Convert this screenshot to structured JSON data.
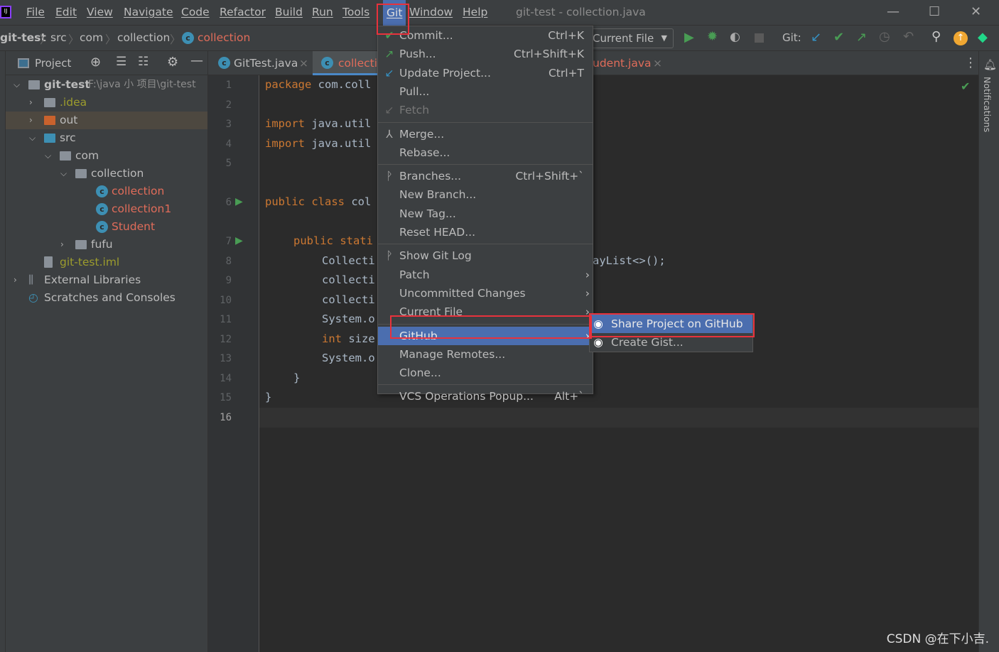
{
  "menubar": {
    "items": [
      "File",
      "Edit",
      "View",
      "Navigate",
      "Code",
      "Refactor",
      "Build",
      "Run",
      "Tools",
      "Git",
      "Window",
      "Help"
    ],
    "title": "git-test - collection.java"
  },
  "breadcrumb": [
    "git-test",
    "src",
    "com",
    "collection",
    "collection"
  ],
  "toolbar": {
    "run_config": "Current File",
    "git_label": "Git:"
  },
  "project": {
    "title": "Project",
    "tree": [
      {
        "label": "git-test",
        "extra": "F:\\java 小 项目\\git-test",
        "depth": 0,
        "open": true,
        "icon": "module-folder",
        "color": "#bbbbbb",
        "bold": true
      },
      {
        "label": ".idea",
        "depth": 1,
        "open": false,
        "icon": "folder",
        "color": "#9c9c2d"
      },
      {
        "label": "out",
        "depth": 1,
        "open": false,
        "icon": "excluded-folder",
        "color": "#bbbbbb",
        "highlight": true
      },
      {
        "label": "src",
        "depth": 1,
        "open": true,
        "icon": "source-folder",
        "color": "#bbbbbb"
      },
      {
        "label": "com",
        "depth": 2,
        "open": true,
        "icon": "package",
        "color": "#bbbbbb"
      },
      {
        "label": "collection",
        "depth": 3,
        "open": true,
        "icon": "package",
        "color": "#bbbbbb"
      },
      {
        "label": "collection",
        "depth": 4,
        "icon": "class-runnable",
        "color": "#e06c5a"
      },
      {
        "label": "collection1",
        "depth": 4,
        "icon": "class-runnable",
        "color": "#e06c5a"
      },
      {
        "label": "Student",
        "depth": 4,
        "icon": "class",
        "color": "#e06c5a"
      },
      {
        "label": "fufu",
        "depth": 3,
        "open": false,
        "icon": "package",
        "color": "#bbbbbb"
      },
      {
        "label": "git-test.iml",
        "depth": 1,
        "icon": "iml-file",
        "color": "#9c9c2d"
      },
      {
        "label": "External Libraries",
        "depth": 0,
        "open": false,
        "icon": "libraries",
        "color": "#bbbbbb"
      },
      {
        "label": "Scratches and Consoles",
        "depth": 0,
        "icon": "scratches",
        "color": "#bbbbbb"
      }
    ]
  },
  "tabs": [
    {
      "label": "GitTest.java",
      "color": "#bbbbbb"
    },
    {
      "label": "collection.java",
      "color": "#e06c5a",
      "active": true
    },
    {
      "label": "udent.java",
      "color": "#e06c5a"
    }
  ],
  "editor": {
    "lines": [
      {
        "n": "1",
        "kw": "package ",
        "rest": "com.coll",
        "indent": 0
      },
      {
        "n": "2",
        "kw": "",
        "rest": "",
        "indent": 0
      },
      {
        "n": "3",
        "kw": "import ",
        "rest": "java.util",
        "indent": 0
      },
      {
        "n": "4",
        "kw": "import ",
        "rest": "java.util",
        "indent": 0
      },
      {
        "n": "5",
        "kw": "",
        "rest": "",
        "indent": 0
      },
      {
        "n": "6",
        "kw": "public class ",
        "rest": "col",
        "indent": 0
      },
      {
        "n": "7",
        "kw": "public stati",
        "rest": "",
        "indent": 1
      },
      {
        "n": "8",
        "kw": "",
        "rest": "Collecti",
        "indent": 2,
        "tail": "ayList<>();"
      },
      {
        "n": "9",
        "kw": "",
        "rest": "collecti",
        "indent": 2
      },
      {
        "n": "10",
        "kw": "",
        "rest": "collecti",
        "indent": 2
      },
      {
        "n": "11",
        "kw": "",
        "rest": "System.o",
        "indent": 2
      },
      {
        "n": "12",
        "kw": "int ",
        "rest": "size",
        "indent": 2
      },
      {
        "n": "13",
        "kw": "",
        "rest": "System.o",
        "indent": 2
      },
      {
        "n": "14",
        "kw": "",
        "rest": "}",
        "indent": 1
      },
      {
        "n": "15",
        "kw": "",
        "rest": "}",
        "indent": 0
      },
      {
        "n": "16",
        "kw": "",
        "rest": "",
        "indent": 0
      }
    ]
  },
  "git_menu": [
    {
      "label": "Commit...",
      "shortcut": "Ctrl+K",
      "icon": "check"
    },
    {
      "label": "Push...",
      "shortcut": "Ctrl+Shift+K",
      "icon": "push-arrow"
    },
    {
      "label": "Update Project...",
      "shortcut": "Ctrl+T",
      "icon": "update-arrow"
    },
    {
      "label": "Pull..."
    },
    {
      "label": "Fetch",
      "disabled": true,
      "icon": "fetch"
    },
    {
      "sep": true
    },
    {
      "label": "Merge...",
      "icon": "merge"
    },
    {
      "label": "Rebase..."
    },
    {
      "sep": true
    },
    {
      "label": "Branches...",
      "shortcut": "Ctrl+Shift+`",
      "icon": "branch"
    },
    {
      "label": "New Branch..."
    },
    {
      "label": "New Tag..."
    },
    {
      "label": "Reset HEAD..."
    },
    {
      "sep": true
    },
    {
      "label": "Show Git Log",
      "icon": "branch"
    },
    {
      "label": "Patch",
      "submenu": true
    },
    {
      "label": "Uncommitted Changes",
      "submenu": true
    },
    {
      "label": "Current File",
      "submenu": true
    },
    {
      "sep": true
    },
    {
      "label": "GitHub",
      "submenu": true,
      "selected": true
    },
    {
      "label": "Manage Remotes..."
    },
    {
      "label": "Clone..."
    },
    {
      "sep": true
    },
    {
      "label": "VCS Operations Popup...",
      "shortcut": "Alt+`"
    }
  ],
  "github_submenu": [
    {
      "label": "Share Project on GitHub",
      "selected": true,
      "icon": "github"
    },
    {
      "label": "Create Gist...",
      "icon": "github"
    }
  ],
  "right_strip": {
    "notifications": "Notifications"
  },
  "watermark": "CSDN @在下小吉.",
  "colors": {
    "accent": "#4b6eaf",
    "highlight_box": "#e8323c",
    "run_green": "#499c54"
  }
}
